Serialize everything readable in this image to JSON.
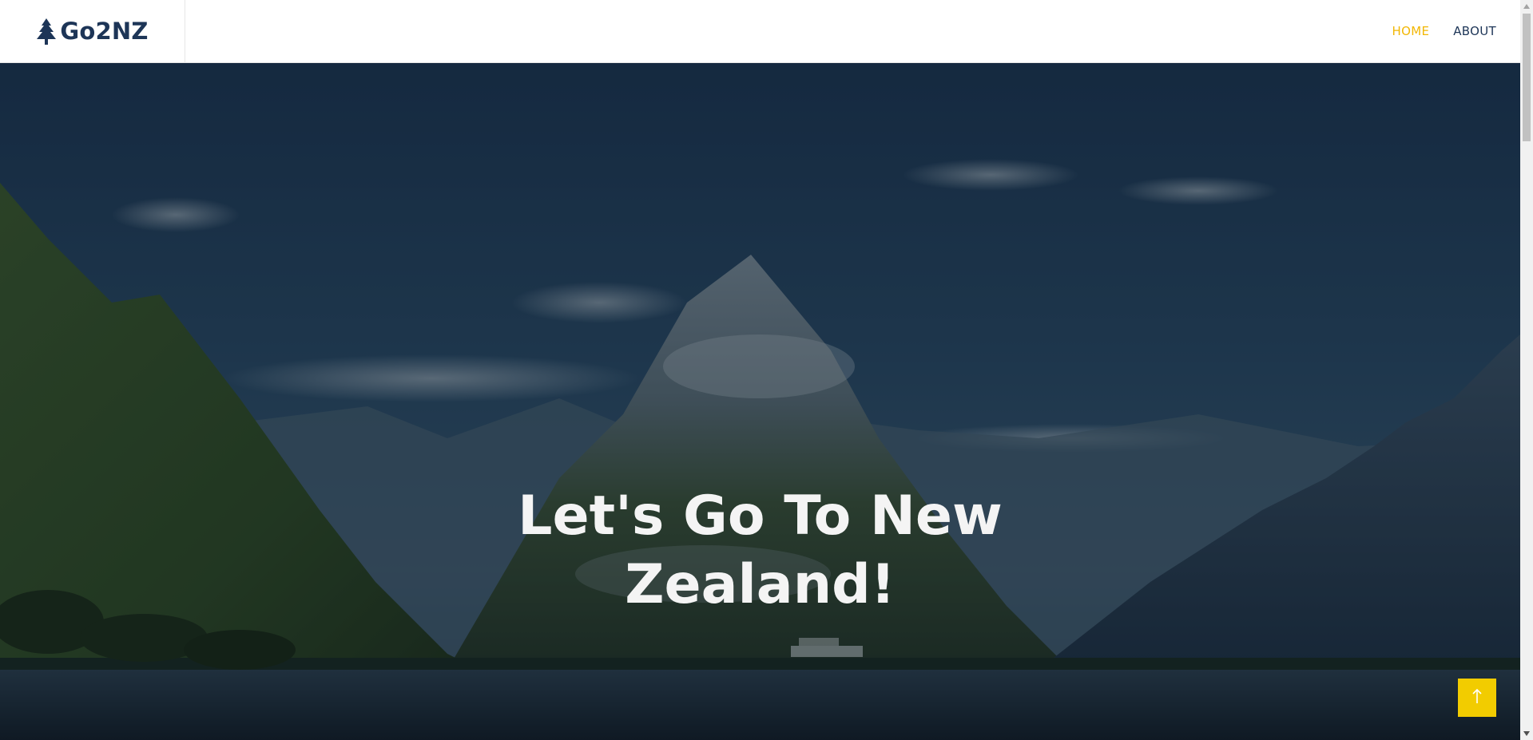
{
  "brand": {
    "name": "Go2NZ",
    "icon": "tree-icon"
  },
  "nav": {
    "items": [
      {
        "label": "HOME",
        "active": true
      },
      {
        "label": "ABOUT",
        "active": false
      }
    ]
  },
  "hero": {
    "title_line1": "Let's Go To New",
    "title_line2": "Zealand!"
  },
  "back_to_top": {
    "icon": "arrow-up-icon"
  },
  "colors": {
    "brand": "#1d3557",
    "accent": "#f2b705",
    "back_to_top_bg": "#f2cc00"
  }
}
